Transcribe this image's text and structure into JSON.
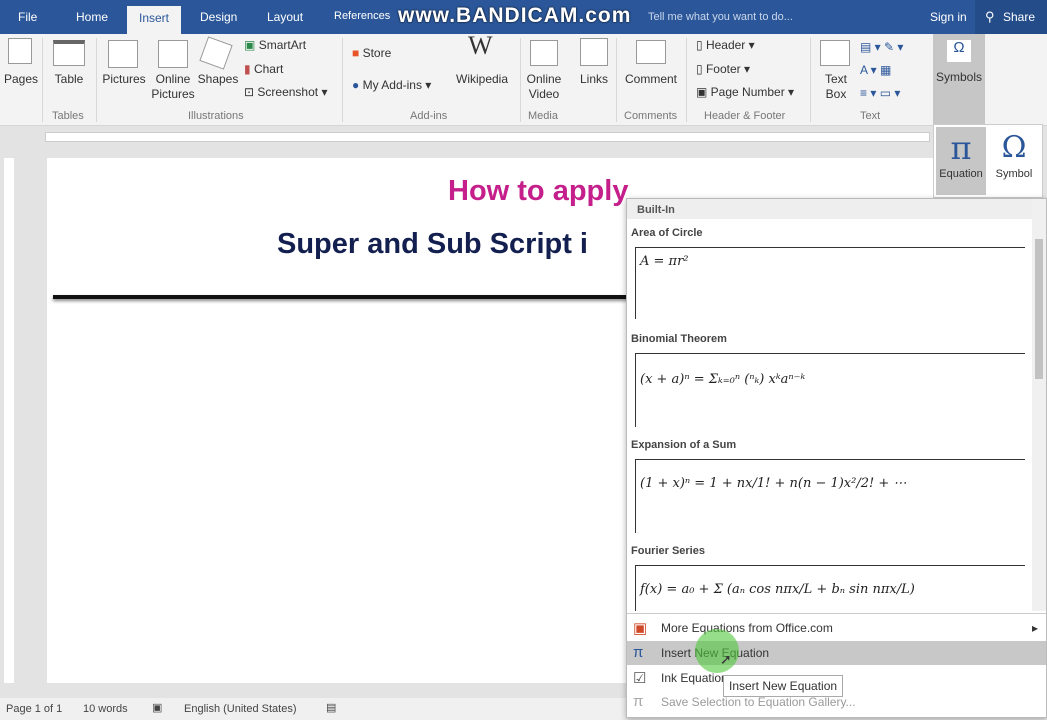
{
  "titlebar": {
    "tabs": [
      "File",
      "Home",
      "Insert",
      "Design",
      "Layout",
      "References"
    ],
    "active_tab": "Insert",
    "watermark": "www.BANDICAM.com",
    "tell_me": "Tell me what you want to do...",
    "sign_in": "Sign in",
    "share": "Share"
  },
  "ribbon": {
    "pages": "Pages",
    "table": "Table",
    "tables_group": "Tables",
    "pictures": "Pictures",
    "online_pictures": "Online Pictures",
    "shapes": "Shapes",
    "smartart": "SmartArt",
    "chart": "Chart",
    "screenshot": "Screenshot",
    "illustrations_group": "Illustrations",
    "store": "Store",
    "my_addins": "My Add-ins",
    "wikipedia": "Wikipedia",
    "addins_group": "Add-ins",
    "online_video": "Online Video",
    "media_group": "Media",
    "links": "Links",
    "comment": "Comment",
    "comments_group": "Comments",
    "header": "Header",
    "footer": "Footer",
    "page_number": "Page Number",
    "hf_group": "Header & Footer",
    "text_box": "Text Box",
    "text_group": "Text",
    "symbols": "Symbols"
  },
  "symbols_dropdown": {
    "equation": "Equation",
    "symbol": "Symbol"
  },
  "document": {
    "title_line1": "How to apply",
    "title_line2": "Super and Sub Script i"
  },
  "gallery": {
    "section": "Built-In",
    "items": [
      {
        "name": "Area of Circle",
        "formula": "A = πr²"
      },
      {
        "name": "Binomial Theorem",
        "formula": "(x + a)ⁿ = Σₖ₌₀ⁿ (ⁿₖ) xᵏaⁿ⁻ᵏ"
      },
      {
        "name": "Expansion of a Sum",
        "formula": "(1 + x)ⁿ = 1 + nx/1! + n(n − 1)x²/2! + ⋯"
      },
      {
        "name": "Fourier Series",
        "formula": "f(x) = a₀ + Σ (aₙ cos nπx/L + bₙ sin nπx/L)"
      }
    ],
    "menu": [
      "More Equations from Office.com",
      "Insert New Equation",
      "Ink Equation",
      "Save Selection to Equation Gallery..."
    ],
    "tooltip": "Insert New Equation"
  },
  "status": {
    "page": "Page 1 of 1",
    "words": "10 words",
    "language": "English (United States)"
  }
}
